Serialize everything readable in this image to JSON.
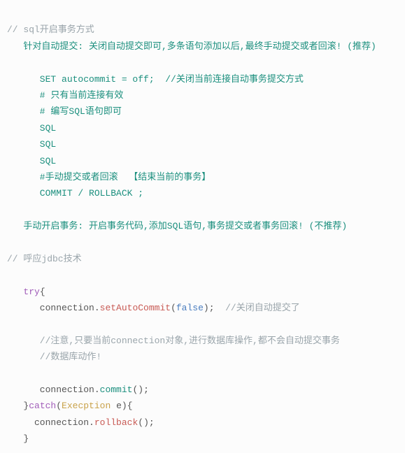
{
  "lines": {
    "l1": "// sql开启事务方式",
    "l2": "   针对自动提交: 关闭自动提交即可,多条语句添加以后,最终手动提交或者回滚! (推荐)",
    "l3": "",
    "l4": "      SET autocommit = off;  //关闭当前连接自动事务提交方式",
    "l5": "      # 只有当前连接有效",
    "l6": "      # 编写SQL语句即可",
    "l7": "      SQL",
    "l8": "      SQL",
    "l9": "      SQL",
    "l10": "      #手动提交或者回滚  【结束当前的事务】",
    "l11": "      COMMIT / ROLLBACK ;",
    "l12": "",
    "l13": "   手动开启事务: 开启事务代码,添加SQL语句,事务提交或者事务回滚! (不推荐)",
    "l14": "",
    "l15": "// 呼应jdbc技术",
    "l16": "",
    "l17_try": "   try",
    "l17_brace": "{",
    "l18_conn": "      connection",
    "l18_dot": ".",
    "l18_method": "setAutoCommit",
    "l18_open": "(",
    "l18_false": "false",
    "l18_close": ")",
    "l18_semi": ";",
    "l18_comment": "  //关闭自动提交了",
    "l19": "",
    "l20": "      //注意,只要当前connection对象,进行数据库操作,都不会自动提交事务",
    "l21": "      //数据库动作!",
    "l22": "",
    "l23_conn": "      connection",
    "l23_dot": ".",
    "l23_method": "commit",
    "l23_open": "(",
    "l23_close": ")",
    "l23_semi": ";",
    "l24_close": "   }",
    "l24_catch": "catch",
    "l24_open": "(",
    "l24_type": "Execption",
    "l24_var": " e",
    "l24_closep": ")",
    "l24_brace": "{",
    "l25_conn": "     connection",
    "l25_dot": ".",
    "l25_method": "rollback",
    "l25_open": "(",
    "l25_close": ")",
    "l25_semi": ";",
    "l26": "   }"
  }
}
